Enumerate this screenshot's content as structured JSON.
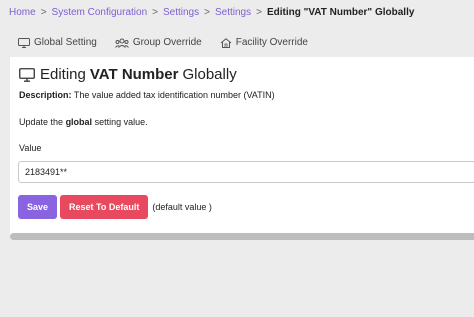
{
  "breadcrumb": {
    "items": [
      "Home",
      "System Configuration",
      "Settings",
      "Settings"
    ],
    "separator": ">",
    "current": "Editing \"VAT Number\" Globally"
  },
  "tabs": [
    {
      "label": "Global Setting",
      "icon": "monitor-icon"
    },
    {
      "label": "Group Override",
      "icon": "group-icon"
    },
    {
      "label": "Facility Override",
      "icon": "home-icon"
    }
  ],
  "page": {
    "title_prefix": "Editing",
    "title_name": "VAT Number",
    "title_suffix": "Globally",
    "description_label": "Description:",
    "description_text": "The value added tax identification number (VATIN)",
    "update_prefix": "Update the",
    "update_bold": "global",
    "update_suffix": "setting value.",
    "value_label": "Value",
    "value": "2183491**"
  },
  "actions": {
    "save_label": "Save",
    "reset_label": "Reset To Default",
    "default_note": "(default value )"
  },
  "colors": {
    "link": "#7d5fd3",
    "save": "#8a63e0",
    "reset": "#e8495f"
  }
}
